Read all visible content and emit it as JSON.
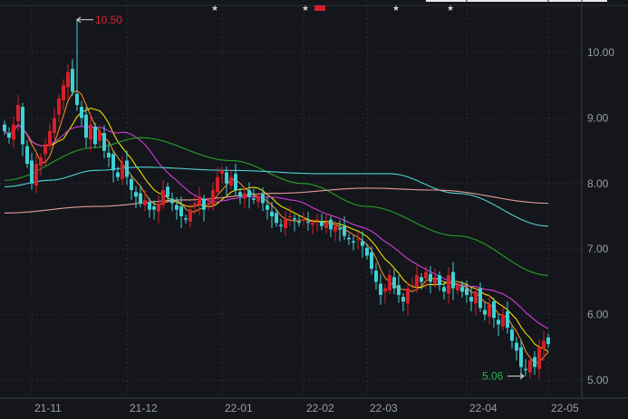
{
  "chart_data": {
    "type": "candlestick",
    "title": "",
    "y_axis": {
      "ticks": [
        "10.00",
        "9.00",
        "8.00",
        "7.00",
        "6.00",
        "5.00"
      ],
      "tick_values": [
        10,
        9,
        8,
        7,
        6,
        5
      ],
      "ylim": [
        4.8,
        10.8
      ],
      "position": "right"
    },
    "x_axis": {
      "labels": [
        "21-11",
        "21-12",
        "22-01",
        "22-02",
        "22-03",
        "22-04",
        "22-05"
      ],
      "label_bar_index": [
        6,
        27,
        48,
        66,
        80,
        102,
        120
      ]
    },
    "close": [
      8.8,
      8.7,
      8.9,
      9.2,
      8.6,
      8.3,
      8.0,
      8.3,
      8.4,
      8.6,
      8.8,
      9.0,
      9.3,
      9.5,
      9.7,
      9.4,
      9.2,
      9.0,
      8.7,
      8.9,
      8.6,
      8.8,
      8.5,
      8.4,
      8.2,
      8.1,
      8.3,
      8.1,
      7.9,
      7.8,
      7.7,
      7.75,
      7.6,
      7.6,
      7.7,
      7.9,
      7.8,
      7.7,
      7.6,
      7.5,
      7.45,
      7.6,
      7.7,
      7.8,
      7.6,
      7.7,
      7.9,
      8.1,
      8.2,
      8.0,
      8.1,
      7.9,
      7.8,
      7.85,
      7.8,
      7.75,
      7.8,
      7.7,
      7.6,
      7.5,
      7.4,
      7.35,
      7.45,
      7.5,
      7.45,
      7.4,
      7.45,
      7.4,
      7.4,
      7.45,
      7.35,
      7.4,
      7.3,
      7.35,
      7.3,
      7.2,
      7.15,
      7.1,
      7.15,
      7.05,
      6.9,
      6.7,
      6.5,
      6.3,
      6.4,
      6.6,
      6.4,
      6.3,
      6.2,
      6.4,
      6.45,
      6.6,
      6.5,
      6.65,
      6.5,
      6.55,
      6.45,
      6.35,
      6.6,
      6.4,
      6.45,
      6.35,
      6.3,
      6.2,
      6.35,
      6.1,
      6.0,
      6.15,
      5.95,
      5.85,
      6.0,
      5.8,
      5.6,
      5.45,
      5.2,
      5.15,
      5.3,
      5.2,
      5.5,
      5.6,
      5.55
    ],
    "annotations": [
      {
        "label": "10.50",
        "bar_index": 16,
        "value": 10.5,
        "kind": "high",
        "color": "#e0202a"
      },
      {
        "label": "5.06",
        "bar_index": 115,
        "value": 5.06,
        "kind": "low",
        "color": "#2fae5a"
      }
    ],
    "event_markers": [
      46,
      66,
      69,
      86,
      98
    ],
    "moving_averages": [
      {
        "name": "MA5",
        "color": "#f08a24",
        "period": 5
      },
      {
        "name": "MA10",
        "color": "#f2e000",
        "period": 10
      },
      {
        "name": "MA20",
        "color": "#d43bd8",
        "period": 20
      },
      {
        "name": "MA60",
        "color": "#2aa02a",
        "points": [
          [
            0,
            8.05
          ],
          [
            20,
            8.55
          ],
          [
            30,
            8.7
          ],
          [
            50,
            8.35
          ],
          [
            66,
            8.0
          ],
          [
            80,
            7.65
          ],
          [
            100,
            7.2
          ],
          [
            120,
            6.6
          ]
        ]
      },
      {
        "name": "MA120",
        "color": "#4fd3d6",
        "points": [
          [
            0,
            7.95
          ],
          [
            10,
            8.05
          ],
          [
            20,
            8.2
          ],
          [
            30,
            8.25
          ],
          [
            50,
            8.2
          ],
          [
            70,
            8.15
          ],
          [
            85,
            8.15
          ],
          [
            100,
            7.85
          ],
          [
            120,
            7.35
          ]
        ]
      },
      {
        "name": "MA250",
        "color": "#e79a9a",
        "points": [
          [
            0,
            7.55
          ],
          [
            20,
            7.65
          ],
          [
            40,
            7.75
          ],
          [
            60,
            7.85
          ],
          [
            80,
            7.93
          ],
          [
            95,
            7.9
          ],
          [
            120,
            7.7
          ]
        ]
      }
    ],
    "colors": {
      "up": "#d3202a",
      "down": "#3fd0d4",
      "background": "#14161b",
      "grid": "#2a2d33"
    }
  }
}
